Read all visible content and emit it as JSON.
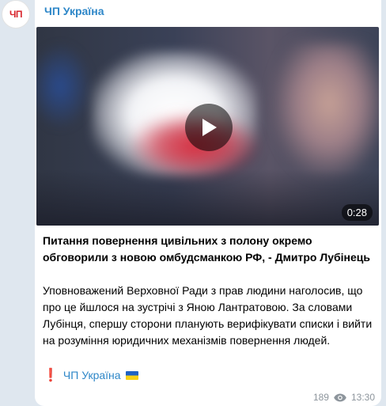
{
  "channel": {
    "avatar_text": "ЧП",
    "name": "ЧП Україна"
  },
  "video": {
    "duration": "0:28"
  },
  "post": {
    "headline": "Питання повернення цивільних з полону окремо обговорили з новою омбудсманкою РФ, - Дмитро Лубінець",
    "body": "Уповноважений Верховної Ради з прав людини наголосив, що про це йшлося на зустрічі з Яною Лантратовою. За словами Лубінця, спершу сторони планують верифікувати списки і вийти на розуміння юридичних механізмів повернення людей.",
    "signature_link": "ЧП Україна"
  },
  "meta": {
    "views": "189",
    "time": "13:30"
  },
  "colors": {
    "link": "#2e87c8",
    "background": "#dfe7ef",
    "bubble": "#ffffff",
    "meta_text": "#8d959c"
  },
  "icons": {
    "play": "play-icon",
    "views": "eye-icon",
    "signature_mark": "exclamation-icon",
    "flag": "ukraine-flag-icon"
  }
}
